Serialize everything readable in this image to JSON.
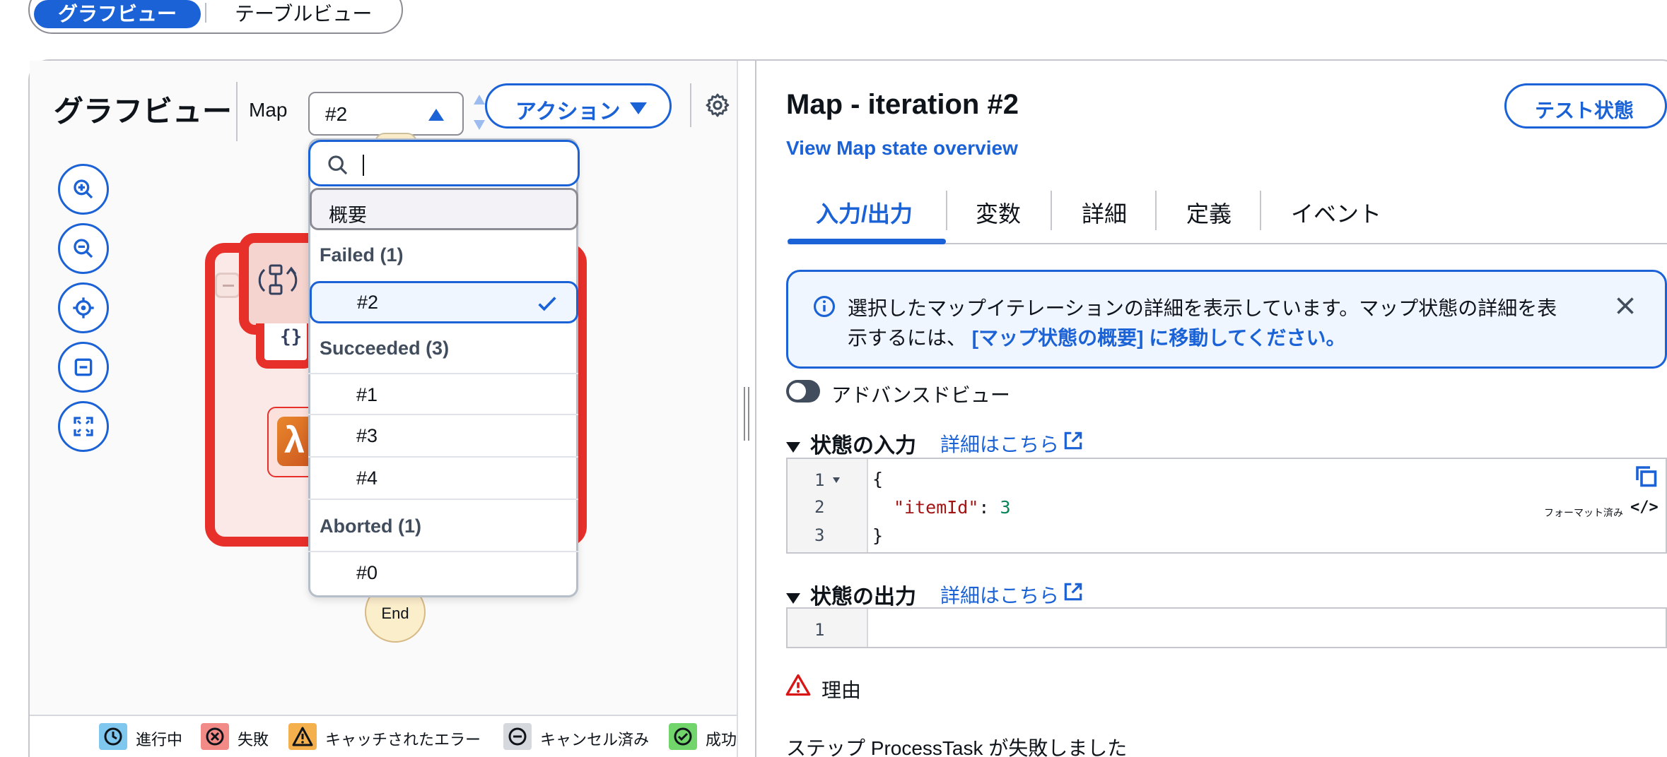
{
  "view_toggle": {
    "graph_view": "グラフビュー",
    "table_view": "テーブルビュー"
  },
  "graph": {
    "title": "グラフビュー",
    "map_label": "Map",
    "map_selected": "#2",
    "action_label": "アクション",
    "end_label": "End",
    "braces": "{}",
    "lambda_glyph": "λ"
  },
  "dropdown": {
    "search_placeholder": "",
    "overview": "概要",
    "groups": [
      {
        "label": "Failed (1)",
        "items": [
          "#2"
        ]
      },
      {
        "label": "Succeeded (3)",
        "items": [
          "#1",
          "#3",
          "#4"
        ]
      },
      {
        "label": "Aborted (1)",
        "items": [
          "#0"
        ]
      }
    ]
  },
  "legend": [
    {
      "label": "進行中",
      "color": "#7fc7ee"
    },
    {
      "label": "失敗",
      "color": "#f28b87"
    },
    {
      "label": "キャッチされたエラー",
      "color": "#f5b04e"
    },
    {
      "label": "キャンセル済み",
      "color": "#d5d9de"
    },
    {
      "label": "成功",
      "color": "#72d56b"
    }
  ],
  "detail": {
    "title": "Map - iteration #2",
    "overview_link": "View Map state overview",
    "test_button": "テスト状態",
    "tabs": [
      "入力/出力",
      "変数",
      "詳細",
      "定義",
      "イベント"
    ],
    "info_line1": "選択したマップイテレーションの詳細を表示しています。マップ状態の詳細を表",
    "info_line2_prefix": "示するには、",
    "info_line2_link": "[マップ状態の概要] に移動してください。",
    "advanced_view": "アドバンスドビュー",
    "input_section": "状態の入力",
    "output_section": "状態の出力",
    "details_link": "詳細はこちら",
    "input_lines": [
      "1",
      "2",
      "3"
    ],
    "input_code": {
      "open": "{",
      "key": "\"itemId\"",
      "colon": ": ",
      "value": "3",
      "close": "}"
    },
    "output_lines": [
      "1"
    ],
    "formatted_label": "フォーマット済み",
    "formatted_icon": "</>",
    "reason_label": "理由",
    "step_message": "ステップ ProcessTask が失敗しました"
  },
  "colors": {
    "accent": "#1a62d6",
    "failed": "#e8302b"
  }
}
